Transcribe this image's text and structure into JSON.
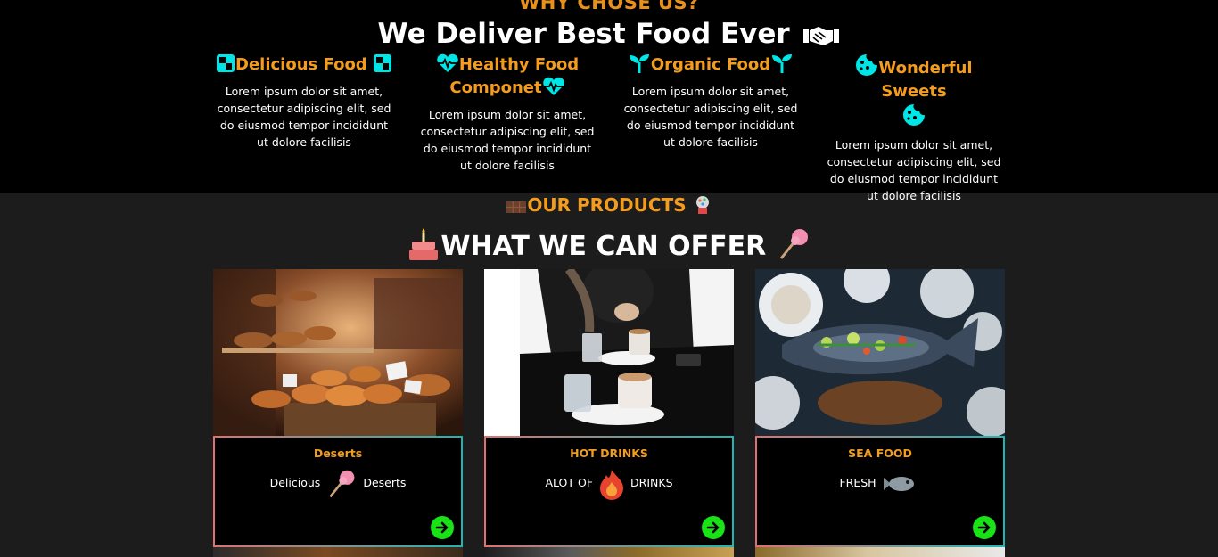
{
  "why": {
    "eyebrow": "WHY CHOSE US?",
    "title": "We Deliver Best Food Ever",
    "features": [
      {
        "title": "Delicious Food",
        "desc": "Lorem ipsum dolor sit amet, consectetur adipiscing elit, sed do eiusmod tempor incididunt ut dolore facilisis",
        "icon": "checkered-square-icon"
      },
      {
        "title_line1": "Healthy Food",
        "title_line2": "Componet",
        "desc": "Lorem ipsum dolor sit amet, consectetur adipiscing elit, sed do eiusmod tempor incididunt ut dolore facilisis",
        "icon": "heartbeat-icon"
      },
      {
        "title": "Organic Food",
        "desc": "Lorem ipsum dolor sit amet, consectetur adipiscing elit, sed do eiusmod tempor incididunt ut dolore facilisis",
        "icon": "seedling-icon"
      },
      {
        "title": "Wonderful Sweets",
        "desc": "Lorem ipsum dolor sit amet, consectetur adipiscing elit, sed do eiusmod tempor incididunt ut dolore facilisis",
        "icon": "cookie-icon"
      }
    ]
  },
  "products": {
    "eyebrow": "OUR PRODUCTS",
    "title": "WHAT WE CAN OFFER",
    "cards": [
      {
        "title": "Deserts",
        "sub_left": "Delicious",
        "sub_right": "Deserts",
        "icon": "lollipop-icon"
      },
      {
        "title": "HOT DRINKS",
        "sub_left": "ALOT OF",
        "sub_right": "DRINKS",
        "icon": "fire-icon"
      },
      {
        "title": "SEA FOOD",
        "sub_left": "FRESH",
        "sub_right": "",
        "icon": "fish-icon"
      }
    ]
  },
  "colors": {
    "accent": "#f39c1d",
    "icon": "#00e5e5",
    "go": "#17e317"
  }
}
